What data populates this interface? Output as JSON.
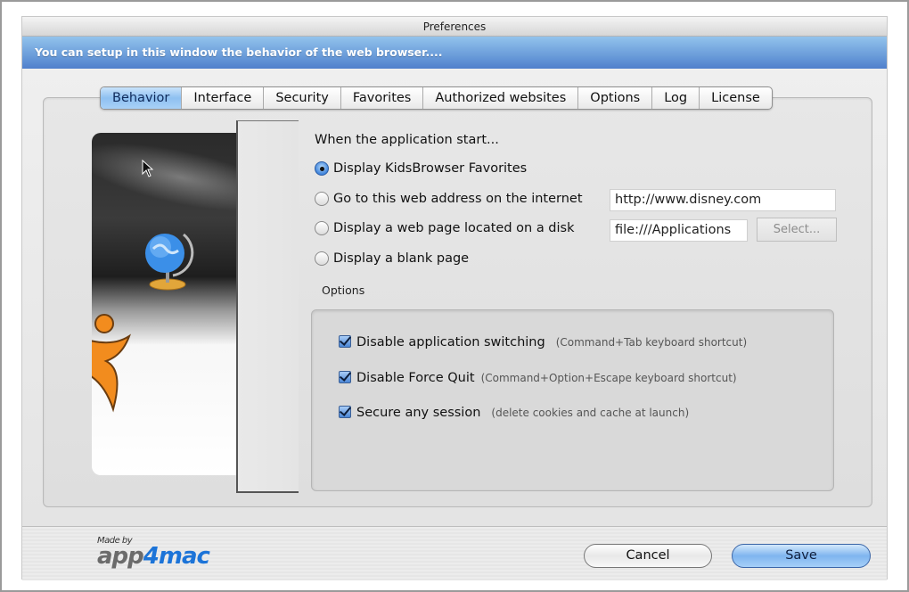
{
  "window": {
    "title": "Preferences",
    "banner": "You can setup in this window the behavior of the web browser...."
  },
  "tabs": [
    {
      "label": "Behavior",
      "active": true
    },
    {
      "label": "Interface",
      "active": false
    },
    {
      "label": "Security",
      "active": false
    },
    {
      "label": "Favorites",
      "active": false
    },
    {
      "label": "Authorized websites",
      "active": false
    },
    {
      "label": "Options",
      "active": false
    },
    {
      "label": "Log",
      "active": false
    },
    {
      "label": "License",
      "active": false
    }
  ],
  "startup": {
    "heading": "When the application start...",
    "options": [
      {
        "label": "Display KidsBrowser Favorites",
        "selected": true
      },
      {
        "label": "Go to this web address on the internet",
        "selected": false
      },
      {
        "label": "Display a web page located on a disk",
        "selected": false
      },
      {
        "label": "Display a blank page",
        "selected": false
      }
    ],
    "web_address_value": "http://www.disney.com",
    "disk_path_value": "file:///Applications",
    "select_button_label": "Select..."
  },
  "options_group": {
    "label": "Options",
    "items": [
      {
        "label": "Disable application switching",
        "hint": "(Command+Tab keyboard shortcut)",
        "checked": true
      },
      {
        "label": "Disable Force Quit",
        "hint": "(Command+Option+Escape keyboard shortcut)",
        "checked": true
      },
      {
        "label": "Secure any session",
        "hint": "(delete cookies and cache at launch)",
        "checked": true
      }
    ]
  },
  "footer": {
    "logo_small": "Made by",
    "logo_part1": "app",
    "logo_part2": "4mac",
    "cancel_label": "Cancel",
    "save_label": "Save"
  },
  "colors": {
    "banner": "#6d9fdb",
    "accent": "#8ec0f1",
    "logo_blue": "#1c74d8"
  },
  "icons": {
    "side_globe": "globe-icon",
    "side_figure": "kid-figure-logo",
    "cursor": "mouse-pointer-icon"
  }
}
